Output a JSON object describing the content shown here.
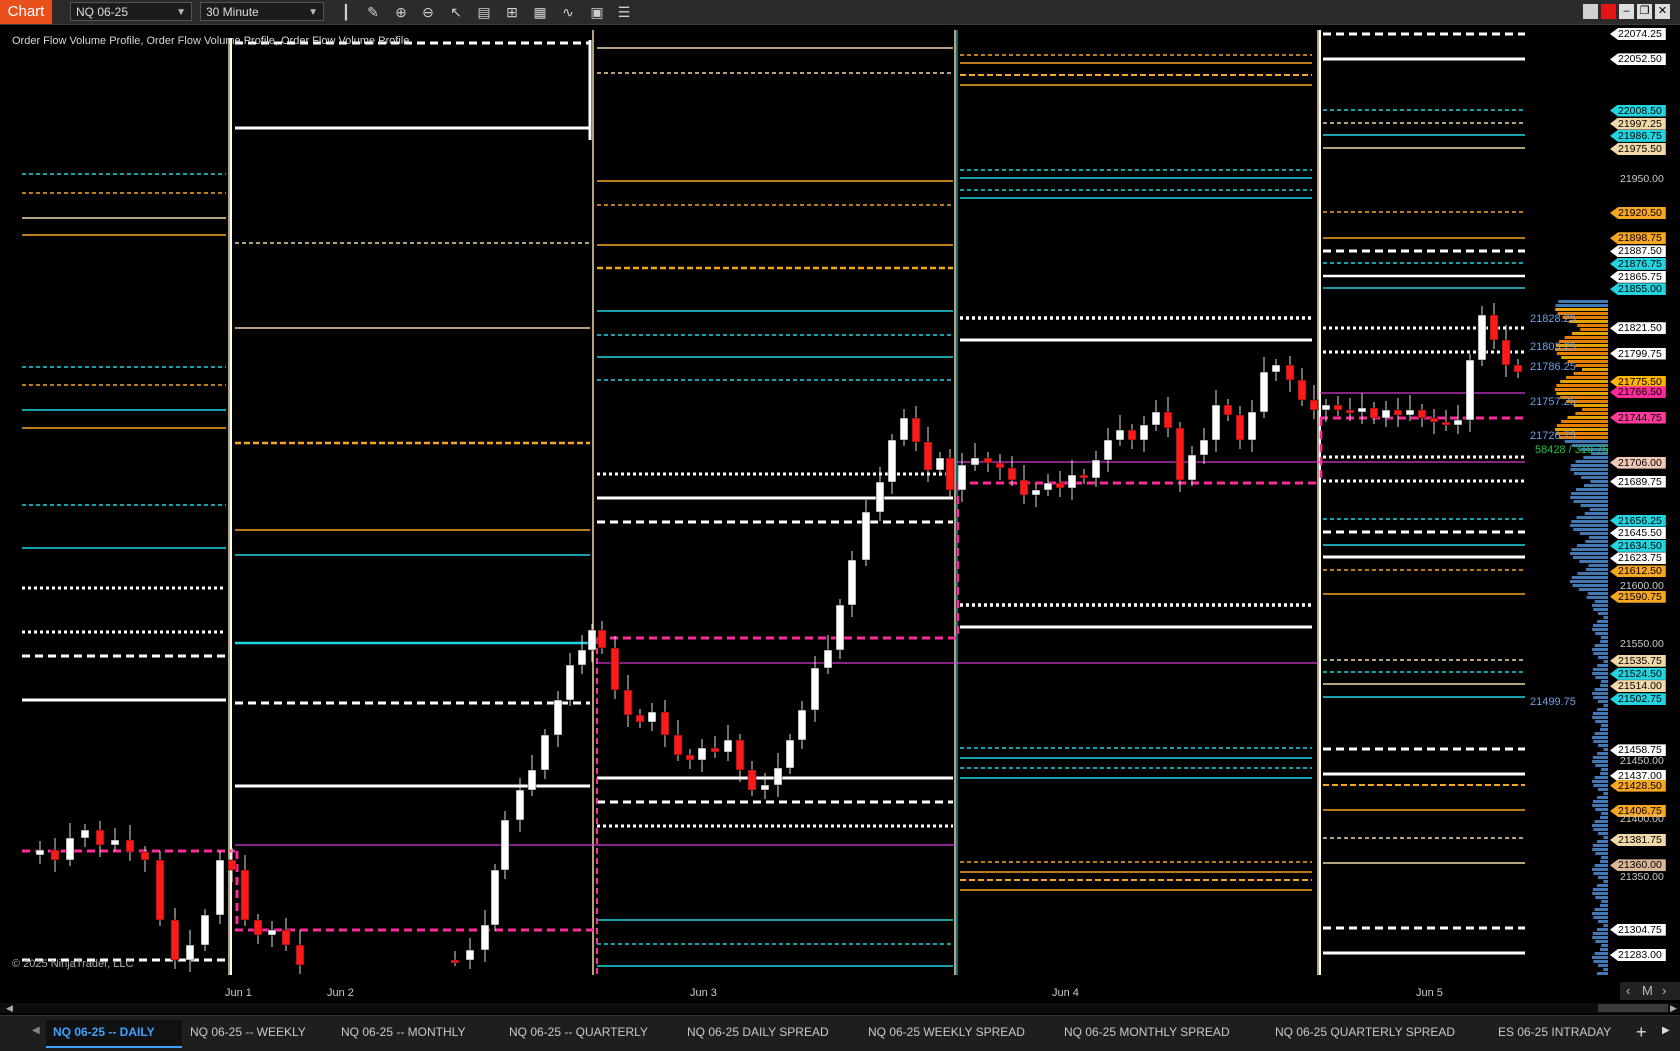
{
  "toolbar": {
    "title": "Chart",
    "instrument": "NQ 06-25",
    "interval": "30 Minute",
    "tools": [
      "bars-icon",
      "pencil-icon",
      "zoom-in-icon",
      "zoom-out-icon",
      "pointer-icon",
      "properties-icon",
      "layout-icon",
      "strategies-icon",
      "indicators-icon",
      "templates-icon",
      "list-icon"
    ]
  },
  "indicator_label": "Order Flow Volume Profile, Order Flow Volume Profile, Order Flow Volume Profile",
  "watermark": "© 2025 NinjaTrader, LLC",
  "price_labels": [
    {
      "text": "22074.25",
      "color": "#ffffff"
    },
    {
      "text": "22052.50",
      "color": "#ffffff"
    },
    {
      "text": "22008.50",
      "color": "#21d4e0"
    },
    {
      "text": "21997.25",
      "color": "#f0d8a8"
    },
    {
      "text": "21986.75",
      "color": "#21d4e0"
    },
    {
      "text": "21975.50",
      "color": "#f0d8a8"
    },
    {
      "text": "21920.50",
      "color": "#f5a623"
    },
    {
      "text": "21898.75",
      "color": "#f5a623"
    },
    {
      "text": "21887.50",
      "color": "#ffffff"
    },
    {
      "text": "21876.75",
      "color": "#21d4e0"
    },
    {
      "text": "21865.75",
      "color": "#ffffff"
    },
    {
      "text": "21855.00",
      "color": "#21d4e0"
    },
    {
      "text": "21821.50",
      "color": "#ffffff"
    },
    {
      "text": "21799.75",
      "color": "#ffffff"
    },
    {
      "text": "21775.50",
      "color": "#ffb400"
    },
    {
      "text": "21766.50",
      "color": "#ff2a9a"
    },
    {
      "text": "21744.75",
      "color": "#ff3a9a"
    },
    {
      "text": "21706.00",
      "color": "#f0c8b8"
    },
    {
      "text": "21689.75",
      "color": "#ffffff"
    },
    {
      "text": "21656.25",
      "color": "#21d4e0"
    },
    {
      "text": "21645.50",
      "color": "#ffffff"
    },
    {
      "text": "21634.50",
      "color": "#21d4e0"
    },
    {
      "text": "21623.75",
      "color": "#ffffff"
    },
    {
      "text": "21612.50",
      "color": "#f5a623"
    },
    {
      "text": "21590.75",
      "color": "#f5a623"
    },
    {
      "text": "21535.75",
      "color": "#f0d8a8"
    },
    {
      "text": "21524.50",
      "color": "#21d4e0"
    },
    {
      "text": "21514.00",
      "color": "#f0d8a8"
    },
    {
      "text": "21502.75",
      "color": "#21d4e0"
    },
    {
      "text": "21458.75",
      "color": "#ffffff"
    },
    {
      "text": "21437.00",
      "color": "#ffffff"
    },
    {
      "text": "21428.50",
      "color": "#f5a623"
    },
    {
      "text": "21406.75",
      "color": "#f5a623"
    },
    {
      "text": "21381.75",
      "color": "#f0d8a8"
    },
    {
      "text": "21360.00",
      "color": "#d8b898"
    },
    {
      "text": "21304.75",
      "color": "#ffffff"
    },
    {
      "text": "21283.00",
      "color": "#ffffff"
    }
  ],
  "price_ticks": [
    "21950.00",
    "21600.00",
    "21550.00",
    "21450.00",
    "21400.00",
    "21350.00"
  ],
  "inline_prices": [
    "21828.25",
    "21803.25",
    "21786.25",
    "21757.25",
    "21726.75",
    "21499.75"
  ],
  "volume_readout": "58428 / 319.75",
  "time_labels": [
    "Jun 1",
    "Jun 2",
    "Jun 3",
    "Jun 4",
    "Jun 5"
  ],
  "tabs": [
    "NQ 06-25 -- DAILY",
    "NQ 06-25 -- WEEKLY",
    "NQ 06-25 -- MONTHLY",
    "NQ 06-25 -- QUARTERLY",
    "NQ 06-25 DAILY SPREAD",
    "NQ 06-25 WEEKLY SPREAD",
    "NQ 06-25 MONTHLY SPREAD",
    "NQ 06-25 QUARTERLY SPREAD",
    "ES 06-25 INTRADAY"
  ],
  "zoom_label": "M",
  "colors": {
    "accent": "#e8501c",
    "bull": "#ffffff",
    "bear": "#ff1a1a",
    "cyan": "#21d4e0",
    "orange": "#f5a623",
    "magenta": "#ff2a9a",
    "profile": "#4a86c5"
  }
}
